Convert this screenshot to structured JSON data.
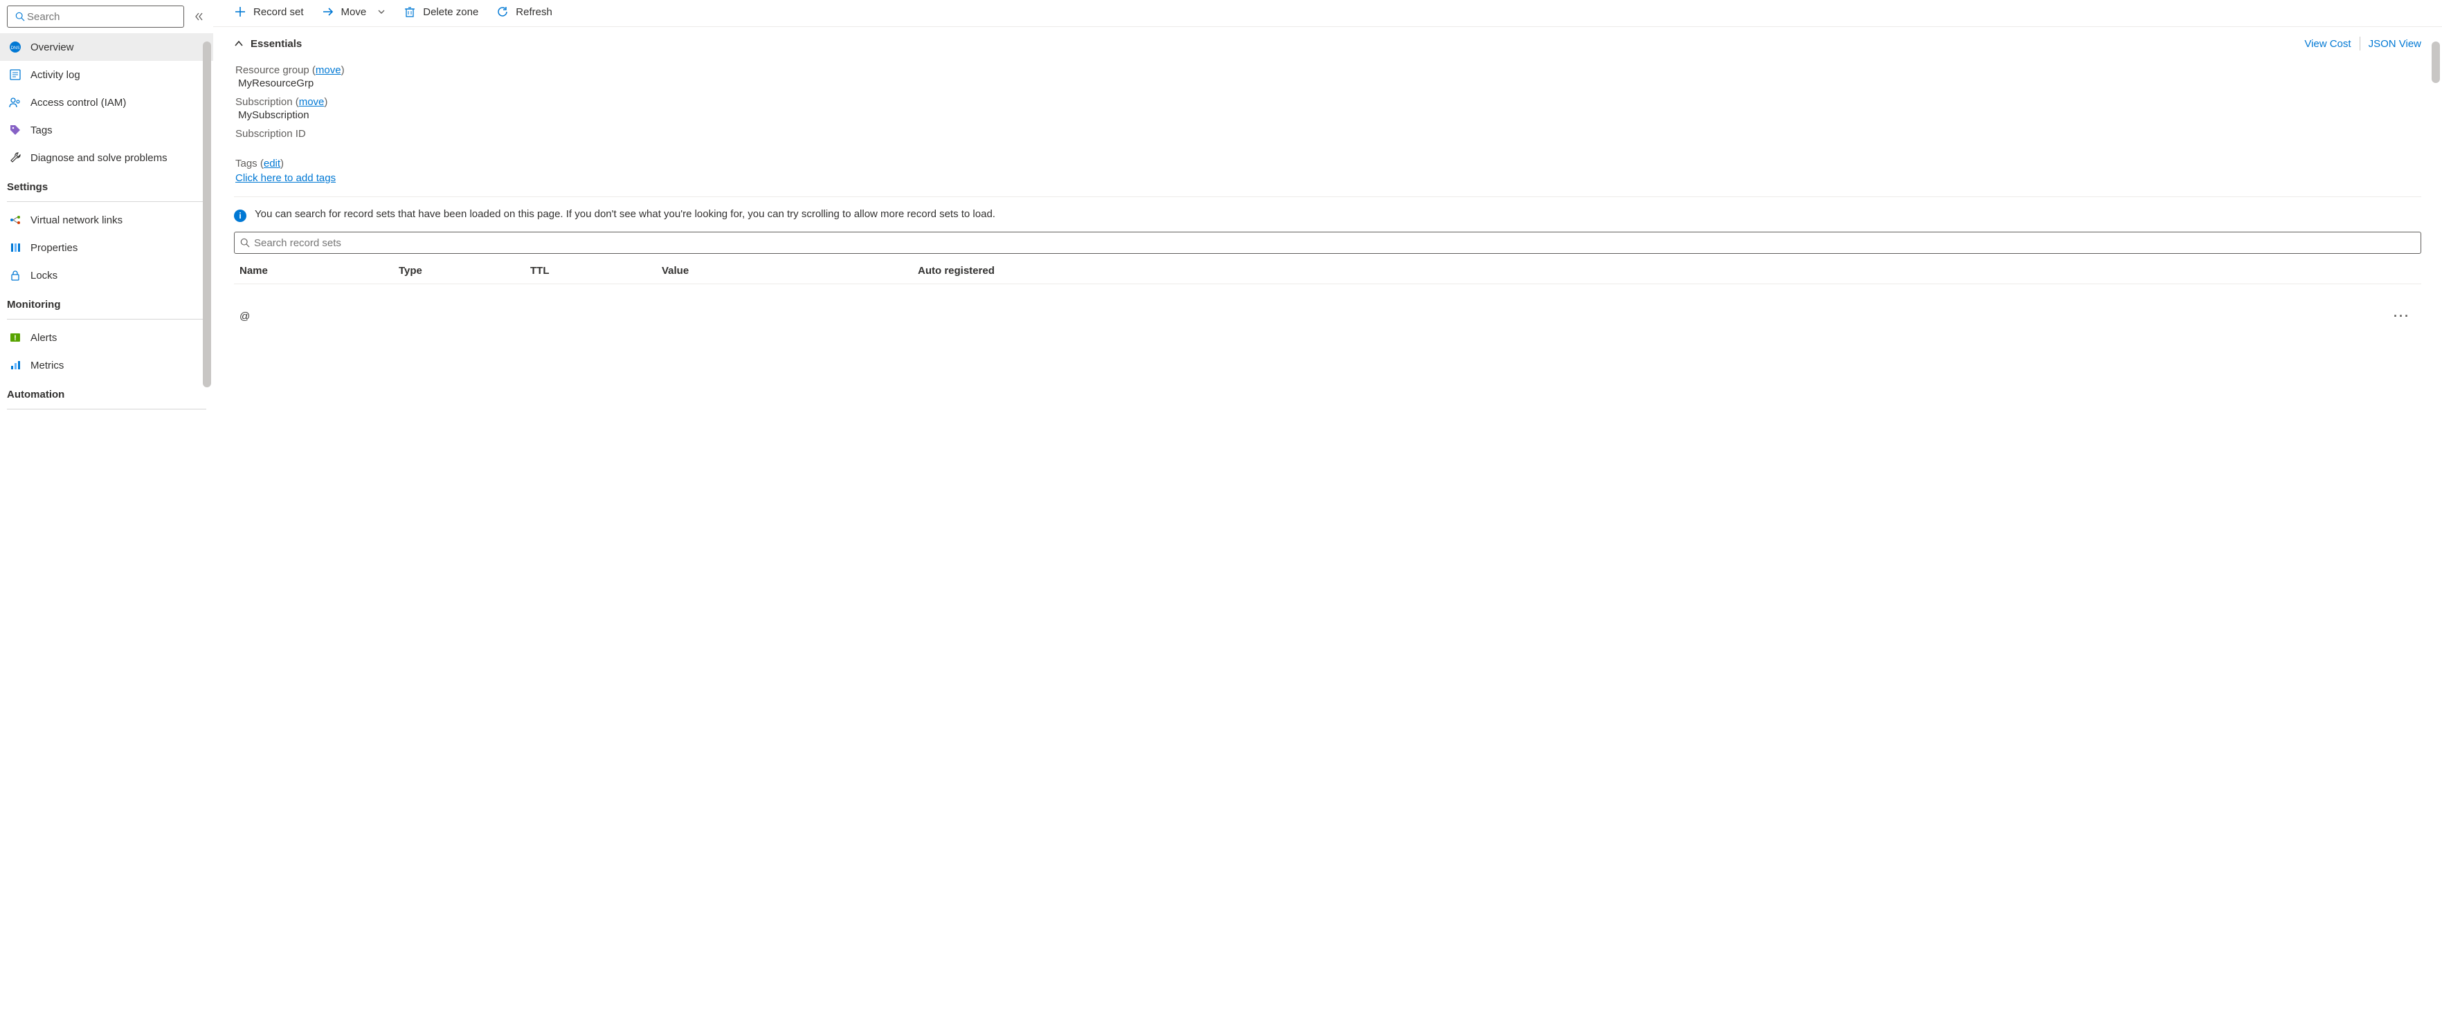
{
  "sidebar": {
    "search_placeholder": "Search",
    "items_general": [
      {
        "label": "Overview",
        "name": "overview"
      },
      {
        "label": "Activity log",
        "name": "activity-log"
      },
      {
        "label": "Access control (IAM)",
        "name": "access-control"
      },
      {
        "label": "Tags",
        "name": "tags"
      },
      {
        "label": "Diagnose and solve problems",
        "name": "diagnose"
      }
    ],
    "section_settings": "Settings",
    "items_settings": [
      {
        "label": "Virtual network links",
        "name": "vnet-links"
      },
      {
        "label": "Properties",
        "name": "properties"
      },
      {
        "label": "Locks",
        "name": "locks"
      }
    ],
    "section_monitoring": "Monitoring",
    "items_monitoring": [
      {
        "label": "Alerts",
        "name": "alerts"
      },
      {
        "label": "Metrics",
        "name": "metrics"
      }
    ],
    "section_automation": "Automation"
  },
  "toolbar": {
    "record_set": "Record set",
    "move": "Move",
    "delete": "Delete zone",
    "refresh": "Refresh"
  },
  "essentials": {
    "title": "Essentials",
    "view_cost": "View Cost",
    "json_view": "JSON View",
    "resource_group_label": "Resource group",
    "move_text": "move",
    "resource_group_value": "MyResourceGrp",
    "subscription_label": "Subscription",
    "subscription_value": "MySubscription",
    "subscription_id_label": "Subscription ID",
    "tags_label": "Tags",
    "edit_text": "edit",
    "add_tags": "Click here to add tags"
  },
  "info_text": "You can search for record sets that have been loaded on this page. If you don't see what you're looking for, you can try scrolling to allow more record sets to load.",
  "recordset_search_placeholder": "Search record sets",
  "table": {
    "cols": {
      "name": "Name",
      "type": "Type",
      "ttl": "TTL",
      "value": "Value",
      "auto": "Auto registered"
    },
    "rows": [
      {
        "name": "@"
      }
    ]
  }
}
